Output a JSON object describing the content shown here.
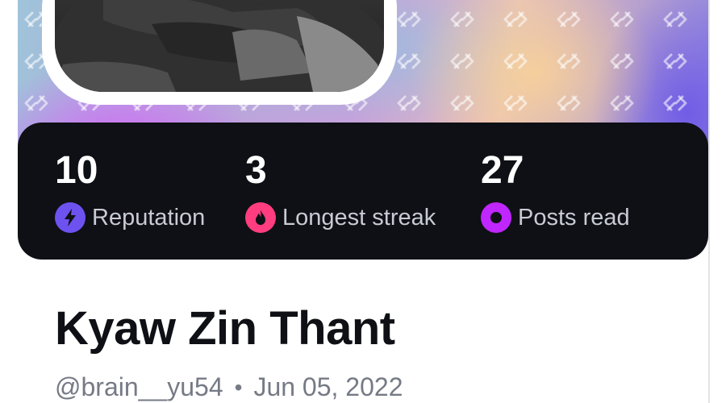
{
  "profile": {
    "name": "Kyaw Zin Thant",
    "username": "@brain__yu54",
    "separator": "•",
    "joined": "Jun 05, 2022"
  },
  "stats": [
    {
      "value": "10",
      "label": "Reputation",
      "icon": "bolt-icon",
      "color": "#6e52f0"
    },
    {
      "value": "3",
      "label": "Longest streak",
      "icon": "flame-icon",
      "color": "#ff3d7f"
    },
    {
      "value": "27",
      "label": "Posts read",
      "icon": "ring-icon",
      "color": "#c026ff"
    }
  ],
  "colors": {
    "stats_background": "#0e1015",
    "name_text": "#0e1015",
    "meta_text": "#757a85"
  }
}
